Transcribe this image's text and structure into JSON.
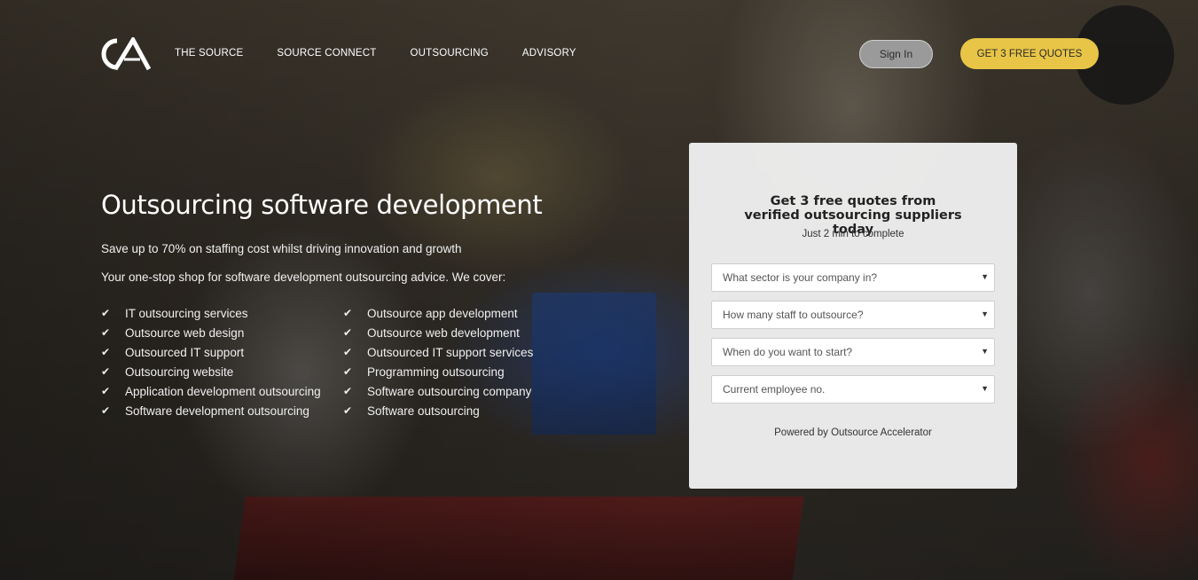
{
  "brand": {
    "logo_text": "CA"
  },
  "nav": {
    "items": [
      "THE SOURCE",
      "SOURCE CONNECT",
      "OUTSOURCING",
      "ADVISORY"
    ]
  },
  "header": {
    "signin_label": "Sign In",
    "quotes_label": "GET 3 FREE QUOTES"
  },
  "hero": {
    "title": "Outsourcing software development",
    "subtitle": "Save up to 70% on staffing cost whilst driving innovation and growth",
    "intro": "Your one-stop shop for software development outsourcing advice.  We cover:",
    "features_left": [
      "IT outsourcing services",
      "Outsource web design",
      "Outsourced IT support",
      "Outsourcing website",
      "Application development outsourcing",
      "Software development outsourcing"
    ],
    "features_right": [
      "Outsource app development",
      "Outsource web development",
      "Outsourced IT support services",
      "Programming outsourcing",
      "Software outsourcing company",
      "Software outsourcing"
    ]
  },
  "form": {
    "title": "Get 3 free quotes from verified outsourcing suppliers today",
    "subtitle": "Just 2 min to complete",
    "selects": [
      "What sector is your company in?",
      "How many staff to outsource?",
      "When do you want to start?",
      "Current employee no."
    ],
    "powered_by": "Powered by Outsource Accelerator"
  },
  "colors": {
    "accent_yellow": "#e8c547",
    "signin_gray": "#9a9a9a",
    "card_bg": "#eeeeee"
  },
  "icons": [
    "logo-icon",
    "check-icon",
    "dropdown-arrow-icon"
  ]
}
